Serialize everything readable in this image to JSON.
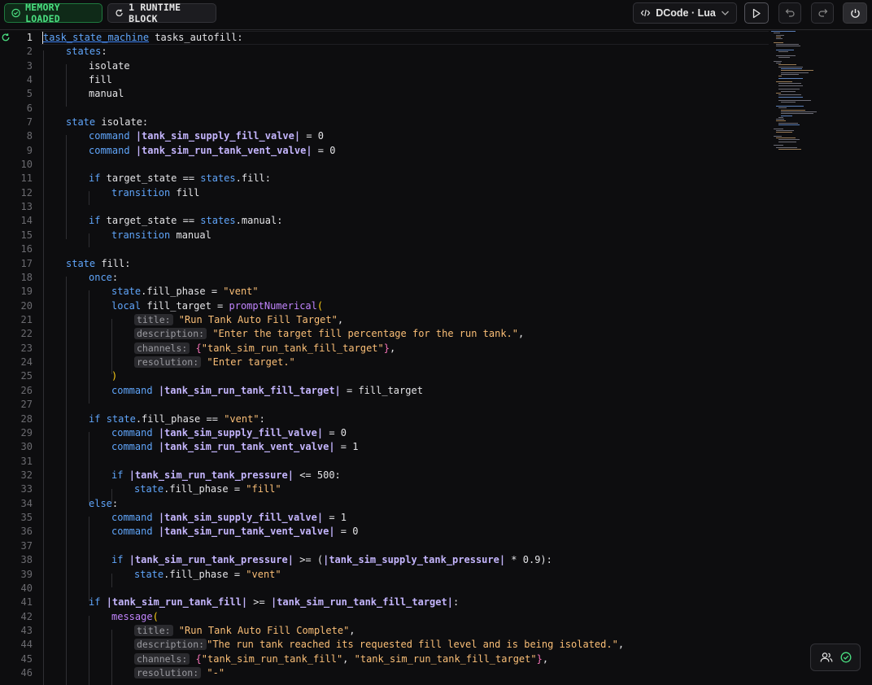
{
  "toolbar": {
    "memory_badge": "MEMORY LOADED",
    "runtime_badge": "1 RUNTIME BLOCK",
    "language_label": "DCode · Lua",
    "colors": {
      "memory_green": "#4ade80",
      "accent_blue": "#60a5fa",
      "accent_purple": "#a78bfa",
      "string_orange": "#fbbf77"
    }
  },
  "editor": {
    "active_line": 1,
    "lines": [
      {
        "n": "1"
      },
      {
        "n": "2"
      },
      {
        "n": "3"
      },
      {
        "n": "4"
      },
      {
        "n": "5"
      },
      {
        "n": "6"
      },
      {
        "n": "7"
      },
      {
        "n": "8"
      },
      {
        "n": "9"
      },
      {
        "n": "10"
      },
      {
        "n": "11"
      },
      {
        "n": "12"
      },
      {
        "n": "13"
      },
      {
        "n": "14"
      },
      {
        "n": "15"
      },
      {
        "n": "16"
      },
      {
        "n": "17"
      },
      {
        "n": "18"
      },
      {
        "n": "19"
      },
      {
        "n": "20"
      },
      {
        "n": "21"
      },
      {
        "n": "22"
      },
      {
        "n": "23"
      },
      {
        "n": "24"
      },
      {
        "n": "25"
      },
      {
        "n": "26"
      },
      {
        "n": "27"
      },
      {
        "n": "28"
      },
      {
        "n": "29"
      },
      {
        "n": "30"
      },
      {
        "n": "31"
      },
      {
        "n": "32"
      },
      {
        "n": "33"
      },
      {
        "n": "34"
      },
      {
        "n": "35"
      },
      {
        "n": "36"
      },
      {
        "n": "37"
      },
      {
        "n": "38"
      },
      {
        "n": "39"
      },
      {
        "n": "40"
      },
      {
        "n": "41"
      },
      {
        "n": "42"
      },
      {
        "n": "43"
      },
      {
        "n": "44"
      },
      {
        "n": "45"
      },
      {
        "n": "46"
      }
    ],
    "code": {
      "l1_a": "task_state_machine",
      "l1_b": " tasks_autofill:",
      "l2_a": "states",
      "l2_b": ":",
      "l3": "isolate",
      "l4": "fill",
      "l5": "manual",
      "l7_a": "state",
      "l7_b": " isolate:",
      "command": "command",
      "ch_supply_valve": "|tank_sim_supply_fill_valve|",
      "ch_vent_valve": "|tank_sim_run_tank_vent_valve|",
      "eq0": " = 0",
      "eq1": " = 1",
      "if": "if",
      "else": "else",
      "once": "once",
      "local": "local",
      "transition": "transition",
      "states": "states",
      "state_obj": "state",
      "l11_b": " target_state == ",
      "l11_c": ".fill:",
      "l12_b": " fill",
      "l14_c": ".manual:",
      "l15_b": " manual",
      "l17_b": " fill:",
      "colon": ":",
      "l19_b": ".fill_phase = ",
      "vent_str": "\"vent\"",
      "fill_str": "\"fill\"",
      "l20_b": " fill_target = ",
      "l20_fn": "promptNumerical",
      "open_paren": "(",
      "close_paren": ")",
      "hint_title": "title:",
      "hint_desc": "description:",
      "hint_channels": "channels:",
      "hint_res": "resolution:",
      "l21_str": "\"Run Tank Auto Fill Target\"",
      "comma": ",",
      "l22_str": "\"Enter the target fill percentage for the run tank.\"",
      "l23_str": "\"tank_sim_run_tank_fill_target\"",
      "l24_str": "\"Enter target.\"",
      "ch_fill_target": "|tank_sim_run_tank_fill_target|",
      "l26_b": " = fill_target",
      "l28_b": " == ",
      "ch_pressure": "|tank_sim_run_tank_pressure|",
      "l32_b": " <= 500:",
      "l38_b": " >= (",
      "ch_supply_pressure": "|tank_sim_supply_tank_pressure|",
      "l38_c": " * 0.9):",
      "ch_fill": "|tank_sim_run_tank_fill|",
      "l41_b": " >= ",
      "message": "message",
      "l43_str": "\"Run Tank Auto Fill Complete\"",
      "l44_str": "\"The run tank reached its requested fill level and is being isolated.\"",
      "l45_str1": "\"tank_sim_run_tank_fill\"",
      "l45_sep": ", ",
      "l45_str2": "\"tank_sim_run_tank_fill_target\"",
      "l46_str": "\"-\"",
      "brace_open": "{",
      "brace_close": "}"
    }
  }
}
